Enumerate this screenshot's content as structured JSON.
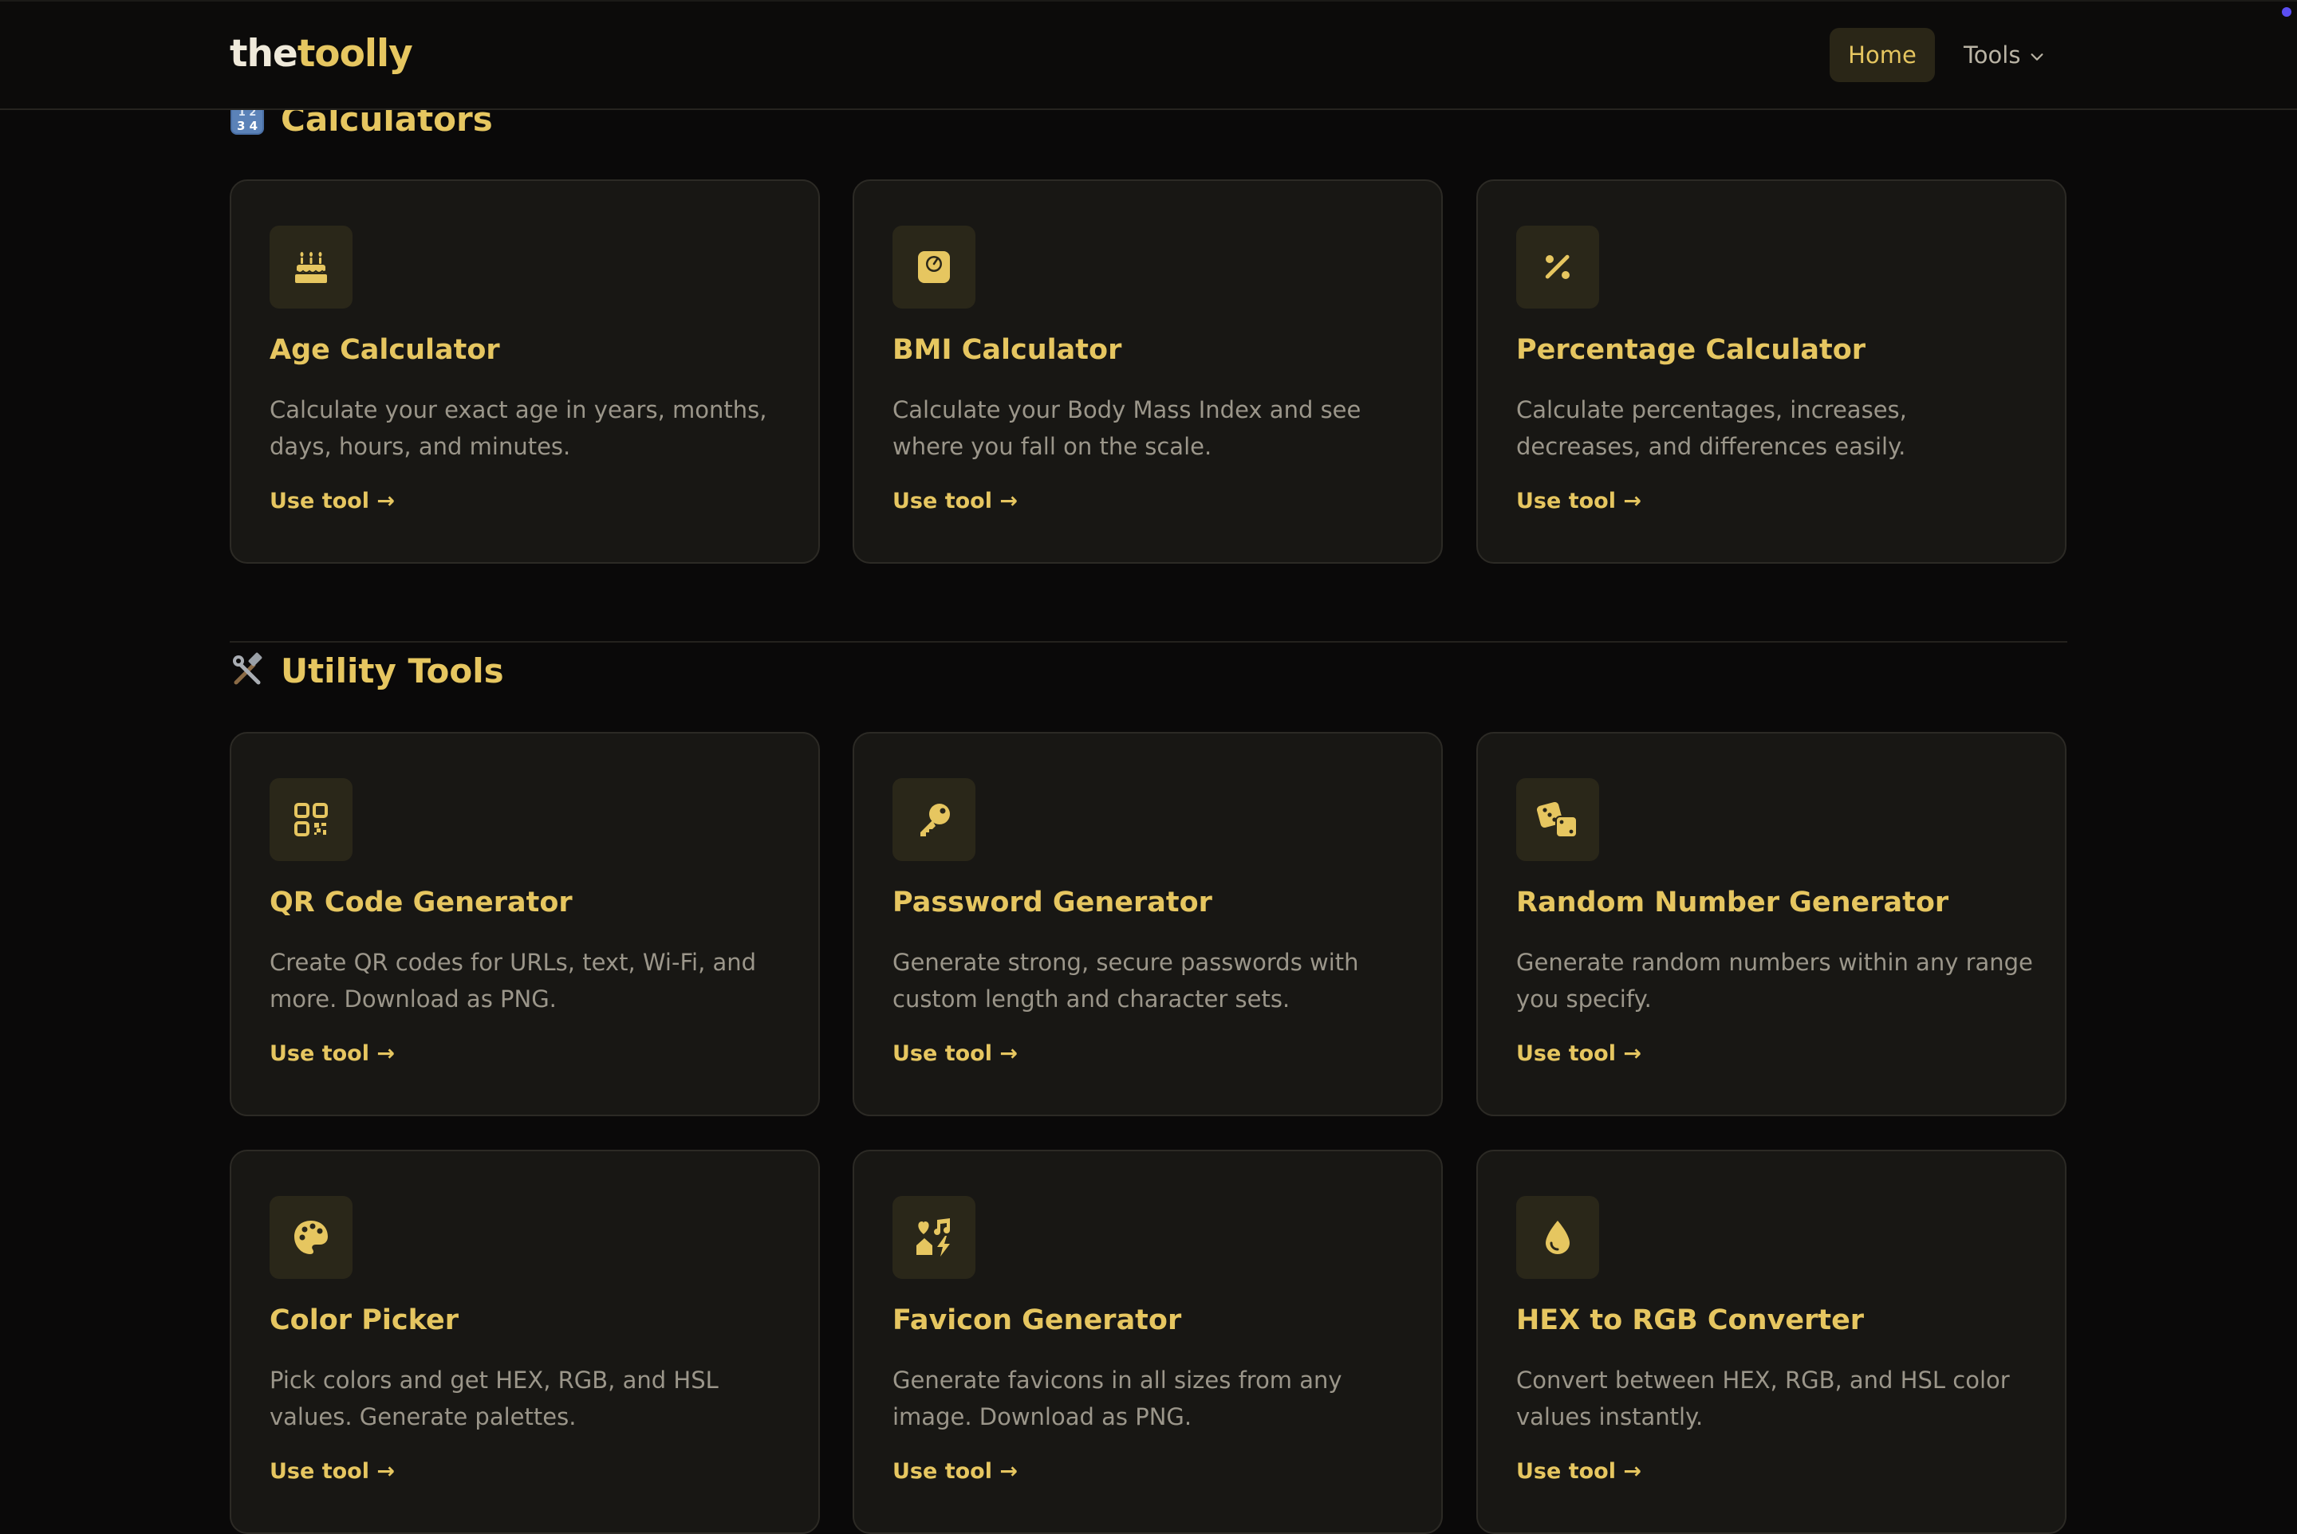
{
  "header": {
    "logo_part1": "the",
    "logo_part2": "toolly",
    "nav_home": "Home",
    "nav_tools": "Tools"
  },
  "sections": [
    {
      "title": "Calculators",
      "emoji": "input-numbers-icon",
      "cards": [
        {
          "title": "Age Calculator",
          "description": "Calculate your exact age in years, months, days, hours, and minutes.",
          "link": "Use tool →",
          "icon": "birthday-cake-icon"
        },
        {
          "title": "BMI Calculator",
          "description": "Calculate your Body Mass Index and see where you fall on the scale.",
          "link": "Use tool →",
          "icon": "weight-scale-icon"
        },
        {
          "title": "Percentage Calculator",
          "description": "Calculate percentages, increases, decreases, and differences easily.",
          "link": "Use tool →",
          "icon": "percent-icon"
        }
      ]
    },
    {
      "title": "Utility Tools",
      "emoji": "hammer-wrench-icon",
      "cards": [
        {
          "title": "QR Code Generator",
          "description": "Create QR codes for URLs, text, Wi-Fi, and more. Download as PNG.",
          "link": "Use tool →",
          "icon": "qr-code-icon"
        },
        {
          "title": "Password Generator",
          "description": "Generate strong, secure passwords with custom length and character sets.",
          "link": "Use tool →",
          "icon": "key-icon"
        },
        {
          "title": "Random Number Generator",
          "description": "Generate random numbers within any range you specify.",
          "link": "Use tool →",
          "icon": "dice-icon"
        },
        {
          "title": "Color Picker",
          "description": "Pick colors and get HEX, RGB, and HSL values. Generate palettes.",
          "link": "Use tool →",
          "icon": "palette-icon"
        },
        {
          "title": "Favicon Generator",
          "description": "Generate favicons in all sizes from any image. Download as PNG.",
          "link": "Use tool →",
          "icon": "icons-icon"
        },
        {
          "title": "HEX to RGB Converter",
          "description": "Convert between HEX, RGB, and HSL color values instantly.",
          "link": "Use tool →",
          "icon": "droplet-icon"
        }
      ]
    }
  ],
  "colors": {
    "accent": "#e6c660",
    "background": "#0a0909",
    "card_bg": "#181714",
    "card_border": "#2c2a25",
    "icon_bg": "#2a2719",
    "muted_text": "#9b968a"
  }
}
